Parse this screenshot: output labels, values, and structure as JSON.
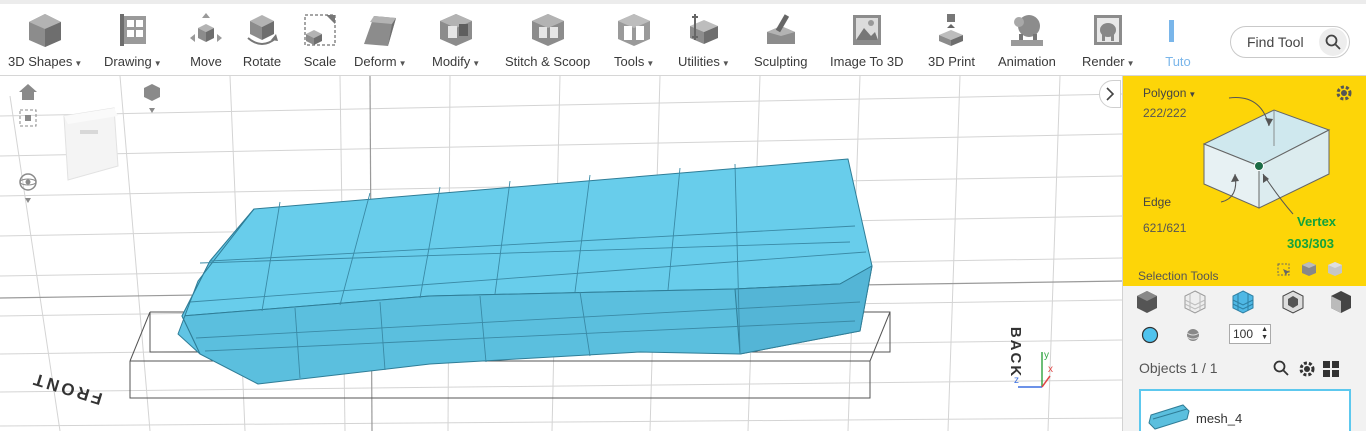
{
  "toolbar": {
    "tools": [
      {
        "id": "3d-shapes",
        "label": "3D Shapes",
        "dropdown": true,
        "icon": "cube-icon"
      },
      {
        "id": "drawing",
        "label": "Drawing",
        "dropdown": true,
        "icon": "drawing-icon"
      },
      {
        "id": "move",
        "label": "Move",
        "dropdown": false,
        "icon": "move-icon"
      },
      {
        "id": "rotate",
        "label": "Rotate",
        "dropdown": false,
        "icon": "rotate-icon"
      },
      {
        "id": "scale",
        "label": "Scale",
        "dropdown": false,
        "icon": "scale-icon"
      },
      {
        "id": "deform",
        "label": "Deform",
        "dropdown": true,
        "icon": "deform-icon"
      },
      {
        "id": "modify",
        "label": "Modify",
        "dropdown": true,
        "icon": "modify-icon"
      },
      {
        "id": "stitch-scoop",
        "label": "Stitch & Scoop",
        "dropdown": false,
        "icon": "stitch-scoop-icon"
      },
      {
        "id": "tools",
        "label": "Tools",
        "dropdown": true,
        "icon": "tools-icon"
      },
      {
        "id": "utilities",
        "label": "Utilities",
        "dropdown": true,
        "icon": "utilities-icon"
      },
      {
        "id": "sculpting",
        "label": "Sculpting",
        "dropdown": false,
        "icon": "sculpting-icon"
      },
      {
        "id": "image-to-3d",
        "label": "Image To 3D",
        "dropdown": false,
        "icon": "image-to-3d-icon"
      },
      {
        "id": "3d-print",
        "label": "3D Print",
        "dropdown": false,
        "icon": "3d-print-icon"
      },
      {
        "id": "animation",
        "label": "Animation",
        "dropdown": false,
        "icon": "animation-icon"
      },
      {
        "id": "render",
        "label": "Render",
        "dropdown": true,
        "icon": "render-icon"
      },
      {
        "id": "tutorials",
        "label": "Tuto",
        "dropdown": false,
        "icon": "tutorials-icon"
      }
    ],
    "find_tool": {
      "label": "Find Tool",
      "icon": "search-icon"
    }
  },
  "viewport": {
    "front_label": "FRONT",
    "back_label": "BACK",
    "axis_labels": {
      "x": "x",
      "y": "y",
      "z": "z"
    },
    "colors": {
      "mesh": "#68cdeb",
      "mesh_edge": "#2f7d97",
      "grid": "#d4d4d4"
    }
  },
  "panel": {
    "selection": {
      "polygon_label": "Polygon",
      "polygon_count": "222/222",
      "edge_label": "Edge",
      "edge_count": "621/621",
      "vertex_label": "Vertex",
      "vertex_count": "303/303",
      "tools_label": "Selection Tools",
      "background": "#fdd508",
      "vertex_color": "#11a33b"
    },
    "opacity": "100",
    "objects": {
      "label": "Objects 1 / 1",
      "items": [
        {
          "name": "mesh_4"
        }
      ]
    }
  }
}
